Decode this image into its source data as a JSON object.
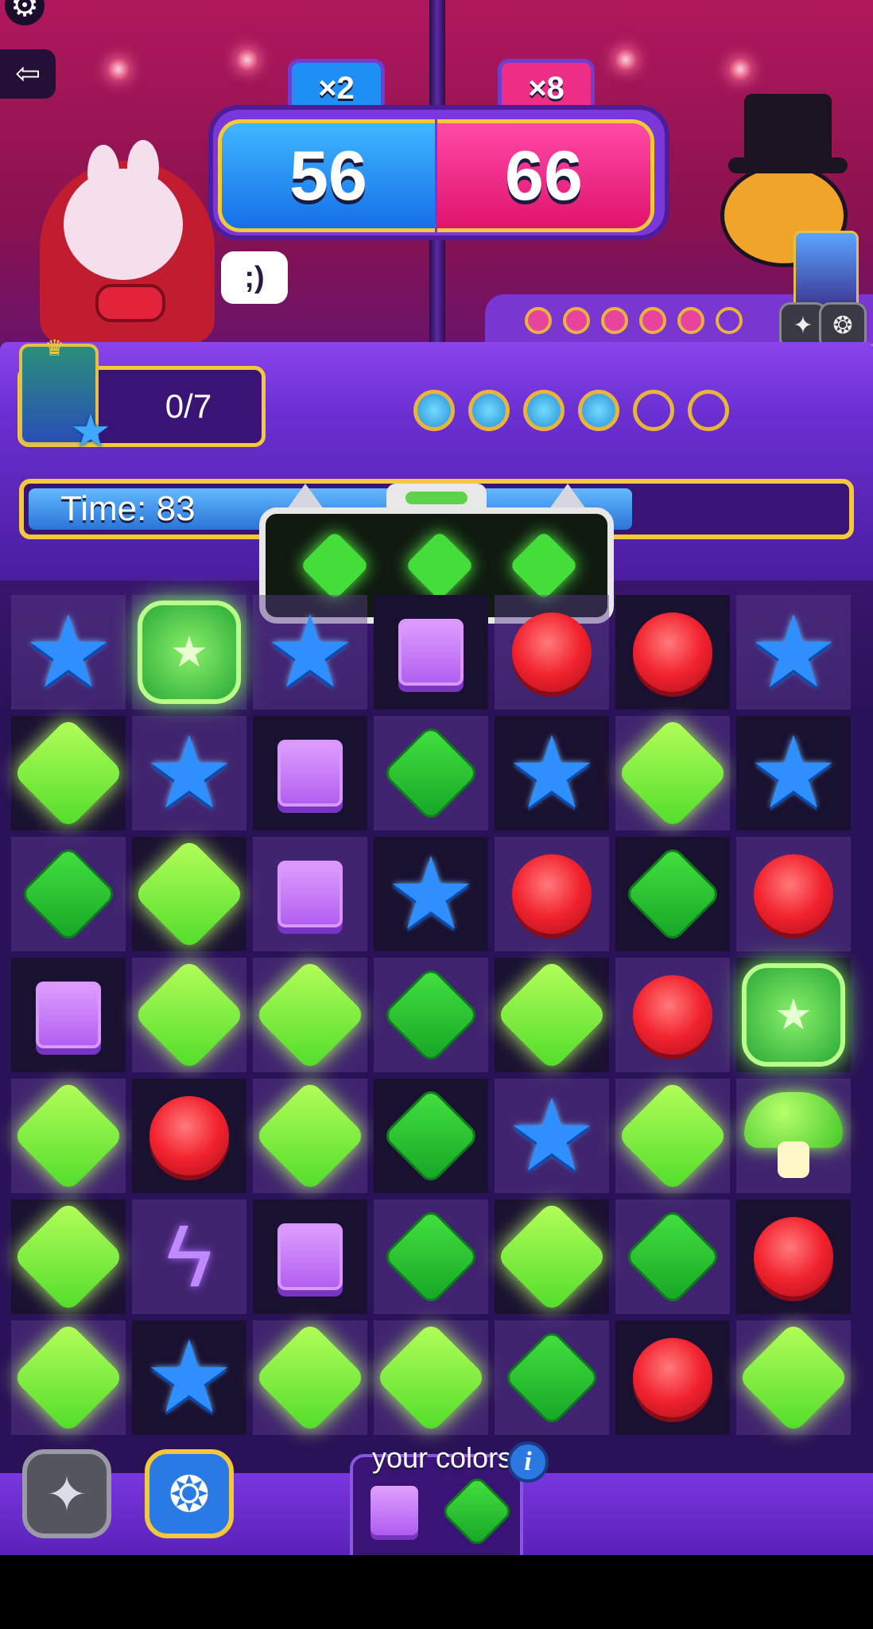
{
  "header": {
    "settings_icon": "gear-icon",
    "exit_icon": "exit-icon"
  },
  "scoreboard": {
    "player_score": "56",
    "opponent_score": "66",
    "player_multiplier": "×2",
    "opponent_multiplier": "×8",
    "player_color": "#1f8ff5",
    "opponent_color": "#ee2d86"
  },
  "player": {
    "emote_icon": "wink-face-icon",
    "goal_progress": "0/7",
    "goal_progress_fraction": 0,
    "round_dots_filled": 4,
    "round_dots_total": 6
  },
  "opponent": {
    "round_dots_filled": 5,
    "round_dots_total": 6
  },
  "timer": {
    "label": "Time: 83",
    "remaining_fraction": 0.74
  },
  "combo": {
    "gem_count": 3,
    "gem_icon": "green-diamond-icon"
  },
  "board": {
    "rows": 7,
    "cols": 7,
    "grid": [
      [
        "star",
        "card",
        "star",
        "purple",
        "red",
        "red",
        "star"
      ],
      [
        "lime",
        "star",
        "purple",
        "green",
        "star",
        "lime",
        "star"
      ],
      [
        "green",
        "lime",
        "purple",
        "star",
        "red",
        "green",
        "red"
      ],
      [
        "purple",
        "lime",
        "lime",
        "green",
        "lime",
        "red",
        "card"
      ],
      [
        "lime",
        "red",
        "lime",
        "green",
        "star",
        "lime",
        "mushroom"
      ],
      [
        "lime",
        "bolt",
        "purple",
        "green",
        "lime",
        "green",
        "red"
      ],
      [
        "lime",
        "star",
        "lime",
        "lime",
        "green",
        "red",
        "lime"
      ]
    ],
    "shade": [
      [
        "light",
        "light",
        "light",
        "dark",
        "light",
        "dark",
        "light"
      ],
      [
        "dark",
        "light",
        "dark",
        "light",
        "dark",
        "light",
        "dark"
      ],
      [
        "light",
        "dark",
        "light",
        "dark",
        "light",
        "dark",
        "light"
      ],
      [
        "dark",
        "light",
        "light",
        "light",
        "dark",
        "light",
        "dark"
      ],
      [
        "light",
        "dark",
        "light",
        "dark",
        "light",
        "light",
        "light"
      ],
      [
        "dark",
        "light",
        "dark",
        "light",
        "dark",
        "light",
        "dark"
      ],
      [
        "light",
        "dark",
        "light",
        "light",
        "light",
        "dark",
        "light"
      ]
    ]
  },
  "bottom": {
    "booster_left_icon": "sparkle-stars-icon",
    "booster_right_icon": "scarab-beetle-icon",
    "your_colors_label": "your colors",
    "info_label": "i",
    "your_colors": [
      "purple-square-icon",
      "green-diamond-icon"
    ]
  }
}
